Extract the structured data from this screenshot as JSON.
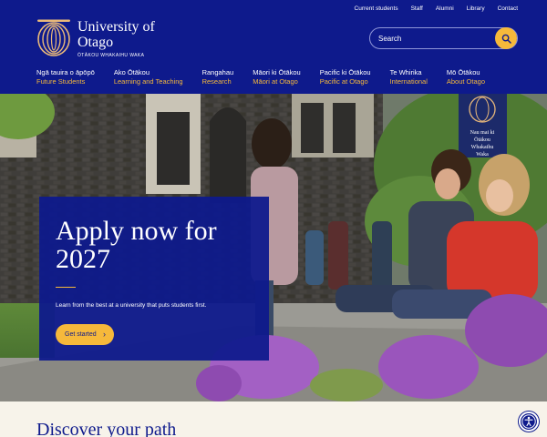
{
  "utility_links": [
    "Current students",
    "Staff",
    "Alumni",
    "Library",
    "Contact"
  ],
  "logo": {
    "title": "University of Otago",
    "subtitle": "ŌTĀKOU WHAKAIHU WAKA"
  },
  "search": {
    "placeholder": "Search",
    "icon": "search-icon"
  },
  "nav": [
    {
      "maori": "Ngā tauira o āpōpō",
      "english": "Future Students"
    },
    {
      "maori": "Ako Ōtākou",
      "english": "Learning and Teaching"
    },
    {
      "maori": "Rangahau",
      "english": "Research"
    },
    {
      "maori": "Māori ki Ōtākou",
      "english": "Māori at Otago"
    },
    {
      "maori": "Pacific ki Ōtākou",
      "english": "Pacific at Otago"
    },
    {
      "maori": "Te Whirika",
      "english": "International"
    },
    {
      "maori": "Mō Ōtākou",
      "english": "About Otago"
    }
  ],
  "hero": {
    "banner_text": "Nau mai ki Ōtākou Whakaihu Waka",
    "heading": "Apply now for 2027",
    "text": "Learn from the best at a university that puts students first.",
    "cta": "Get started"
  },
  "next_section": {
    "heading": "Discover your path"
  },
  "colors": {
    "navy": "#0e1a8c",
    "gold": "#f6b93b",
    "cream": "#f7f3ea"
  },
  "accessibility_button": {
    "icon": "accessibility-icon"
  }
}
